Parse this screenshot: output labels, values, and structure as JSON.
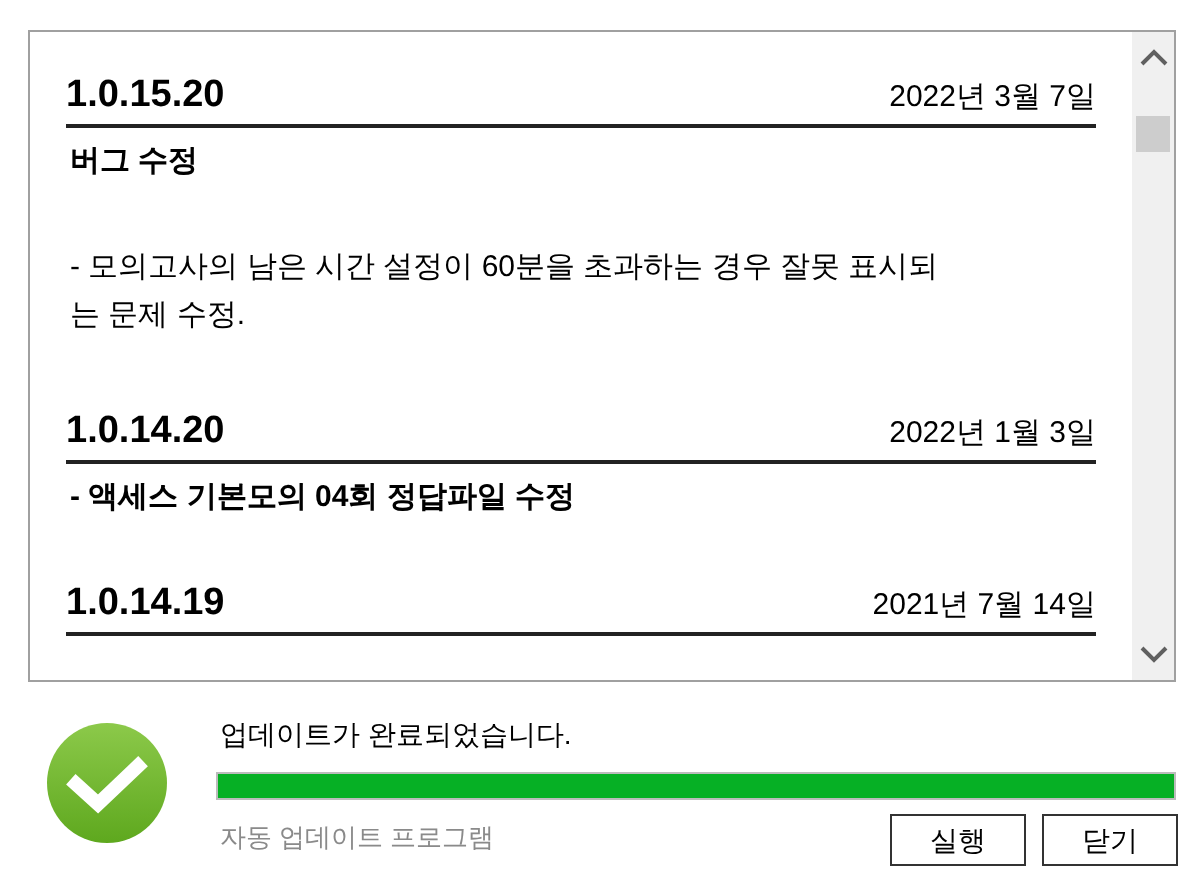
{
  "release_notes": [
    {
      "version": "1.0.15.20",
      "date": "2022년 3월 7일",
      "body": [
        {
          "kind": "heading",
          "text": "버그 수정"
        },
        {
          "kind": "text",
          "text": "- 모의고사의 남은 시간 설정이 60분을 초과하는 경우 잘못 표시되는 문제 수정."
        }
      ]
    },
    {
      "version": "1.0.14.20",
      "date": "2022년 1월 3일",
      "body": [
        {
          "kind": "heading",
          "text": "- 액세스 기본모의 04회 정답파일 수정"
        }
      ]
    },
    {
      "version": "1.0.14.19",
      "date": "2021년 7월 14일"
    }
  ],
  "status": {
    "message": "업데이트가 완료되었습니다.",
    "level": 1,
    "app_name": "자동 업데이트 프로그램"
  },
  "buttons": [
    "실행",
    "닫기"
  ]
}
